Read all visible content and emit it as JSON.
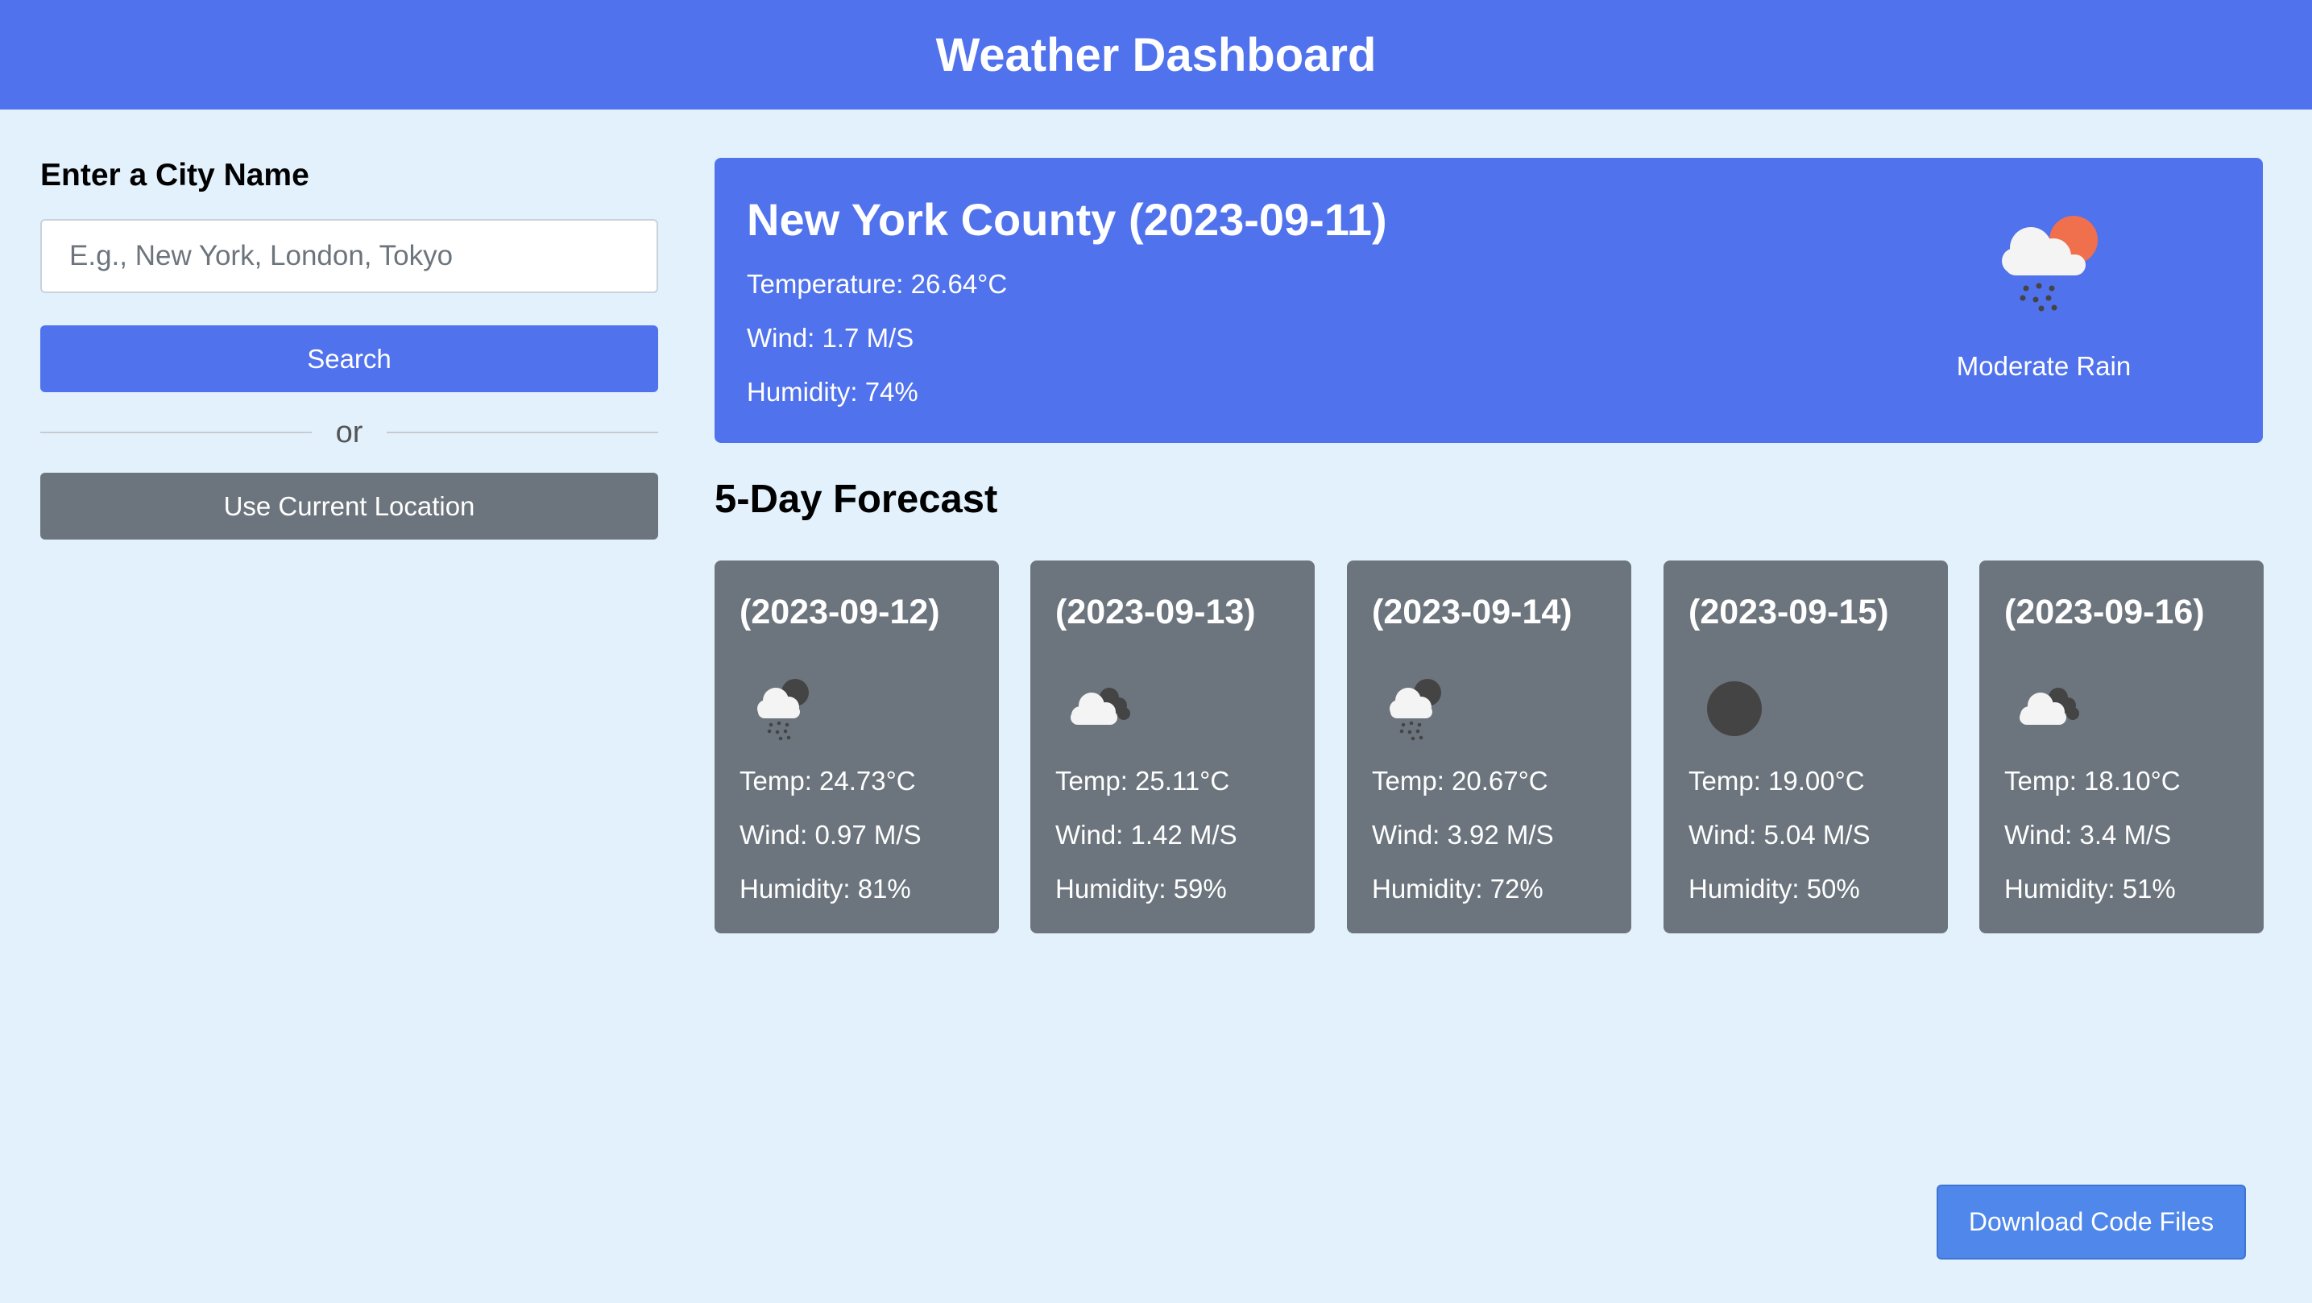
{
  "header": {
    "title": "Weather Dashboard"
  },
  "sidebar": {
    "heading": "Enter a City Name",
    "search_placeholder": "E.g., New York, London, Tokyo",
    "search_value": "",
    "search_button": "Search",
    "divider_text": "or",
    "location_button": "Use Current Location"
  },
  "today": {
    "city": "New York County (2023-09-11)",
    "temperature": "Temperature: 26.64°C",
    "wind": "Wind: 1.7 M/S",
    "humidity": "Humidity: 74%",
    "condition": "Moderate Rain",
    "icon": "rain-cloud-sun-icon"
  },
  "forecast": {
    "title": "5-Day Forecast",
    "days": [
      {
        "date": "(2023-09-12)",
        "temp": "Temp: 24.73°C",
        "wind": "Wind: 0.97 M/S",
        "humidity": "Humidity: 81%",
        "icon": "rain-cloud-night-icon"
      },
      {
        "date": "(2023-09-13)",
        "temp": "Temp: 25.11°C",
        "wind": "Wind: 1.42 M/S",
        "humidity": "Humidity: 59%",
        "icon": "cloudy-night-icon"
      },
      {
        "date": "(2023-09-14)",
        "temp": "Temp: 20.67°C",
        "wind": "Wind: 3.92 M/S",
        "humidity": "Humidity: 72%",
        "icon": "rain-cloud-night-icon"
      },
      {
        "date": "(2023-09-15)",
        "temp": "Temp: 19.00°C",
        "wind": "Wind: 5.04 M/S",
        "humidity": "Humidity: 50%",
        "icon": "clear-night-icon"
      },
      {
        "date": "(2023-09-16)",
        "temp": "Temp: 18.10°C",
        "wind": "Wind: 3.4 M/S",
        "humidity": "Humidity: 51%",
        "icon": "cloudy-night-icon"
      }
    ]
  },
  "download_button": "Download Code Files",
  "colors": {
    "primary": "#5072ec",
    "secondary": "#6c757d",
    "background": "#e3f1fc",
    "sun": "#f0704e",
    "moon": "#444444"
  }
}
